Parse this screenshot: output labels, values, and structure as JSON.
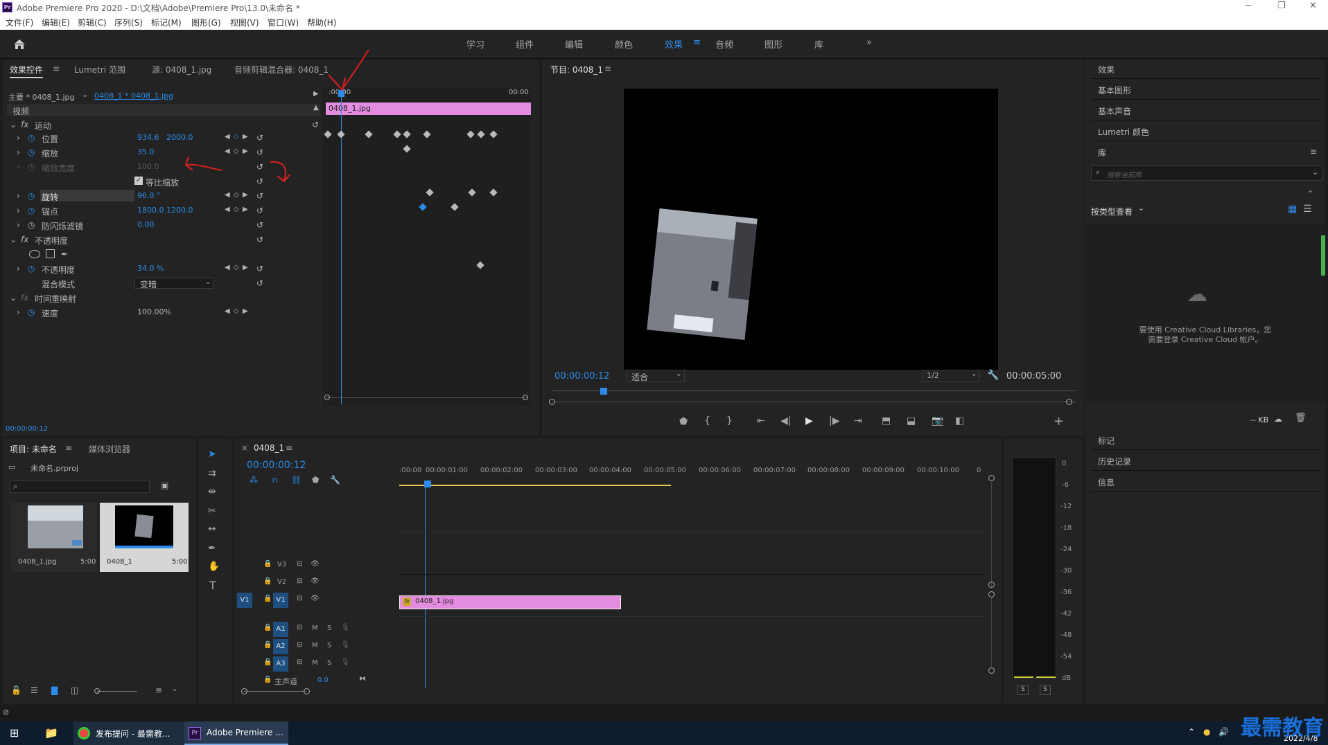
{
  "window": {
    "title": "Adobe Premiere Pro 2020 - D:\\文档\\Adobe\\Premiere Pro\\13.0\\未命名 *",
    "logo": "Pr"
  },
  "menu": [
    "文件(F)",
    "编辑(E)",
    "剪辑(C)",
    "序列(S)",
    "标记(M)",
    "图形(G)",
    "视图(V)",
    "窗口(W)",
    "帮助(H)"
  ],
  "workspaces": [
    "学习",
    "组件",
    "编辑",
    "颜色",
    "效果",
    "音频",
    "图形",
    "库"
  ],
  "active_workspace": "效果",
  "effect_controls": {
    "tabs": [
      "效果控件",
      "Lumetri 范围",
      "源: 0408_1.jpg",
      "音频剪辑混合器: 0408_1"
    ],
    "master": "主要 * 0408_1.jpg",
    "sequence_clip": "0408_1 * 0408_1.jpg",
    "video_label": "视频",
    "ruler_start": ":00:00",
    "ruler_end": "00:00",
    "clip_name": "0408_1.jpg",
    "timecode": "00:00:00:12",
    "motion": "运动",
    "position": {
      "label": "位置",
      "x": "934.6",
      "y": "2000.0"
    },
    "scale": {
      "label": "缩放",
      "value": "35.0"
    },
    "scale_width": {
      "label": "缩放宽度",
      "value": "100.0"
    },
    "uniform_scale": "等比缩放",
    "rotation": {
      "label": "旋转",
      "value": "96.0 °"
    },
    "anchor": {
      "label": "锚点",
      "x": "1800.0",
      "y": "1200.0"
    },
    "flicker": {
      "label": "防闪烁滤镜",
      "value": "0.00"
    },
    "opacity_group": "不透明度",
    "opacity": {
      "label": "不透明度",
      "value": "34.0 %"
    },
    "blend": {
      "label": "混合模式",
      "value": "变暗"
    },
    "time_remap": "时间重映射",
    "speed": {
      "label": "速度",
      "value": "100.00%"
    }
  },
  "program": {
    "title": "节目: 0408_1",
    "timecode": "00:00:00:12",
    "fit": "适合",
    "resolution": "1/2",
    "duration": "00:00:05:00"
  },
  "right_panel": {
    "items": [
      "效果",
      "基本图形",
      "基本声音",
      "Lumetri 颜色",
      "库"
    ],
    "search_placeholder": "搜索当前库",
    "view_by": "按类型查看",
    "cc_message_1": "要使用 Creative Cloud Libraries，您",
    "cc_message_2": "需要登录 Creative Cloud 帐户。",
    "kb": "-- KB",
    "bottom_items": [
      "标记",
      "历史记录",
      "信息"
    ]
  },
  "project": {
    "tabs": [
      "项目: 未命名",
      "媒体浏览器"
    ],
    "file": "未命名.prproj",
    "items": [
      {
        "name": "0408_1.jpg",
        "duration": "5:00"
      },
      {
        "name": "0408_1",
        "duration": "5:00"
      }
    ]
  },
  "timeline": {
    "tab": "0408_1",
    "timecode": "00:00:00:12",
    "ruler": [
      ":00:00",
      "00:00:01:00",
      "00:00:02:00",
      "00:00:03:00",
      "00:00:04:00",
      "00:00:05:00",
      "00:00:06:00",
      "00:00:07:00",
      "00:00:08:00",
      "00:00:09:00",
      "00:00:10:00",
      "0"
    ],
    "video_tracks": [
      "V3",
      "V2",
      "V1"
    ],
    "audio_tracks": [
      "A1",
      "A2",
      "A3"
    ],
    "source_patch": "V1",
    "mute": "M",
    "solo": "S",
    "master": "主声道",
    "master_value": "0.0",
    "clip": "0408_1.jpg"
  },
  "meter": {
    "scale": [
      "0",
      "-6",
      "-12",
      "-18",
      "-24",
      "-30",
      "-36",
      "-42",
      "-48",
      "-54",
      "dB"
    ],
    "solo": [
      "S",
      "S"
    ]
  },
  "taskbar": {
    "chrome": "发布提问 - 最需教...",
    "premiere": "Adobe Premiere ...",
    "date": "2022/4/8",
    "watermark": "最需教育"
  }
}
